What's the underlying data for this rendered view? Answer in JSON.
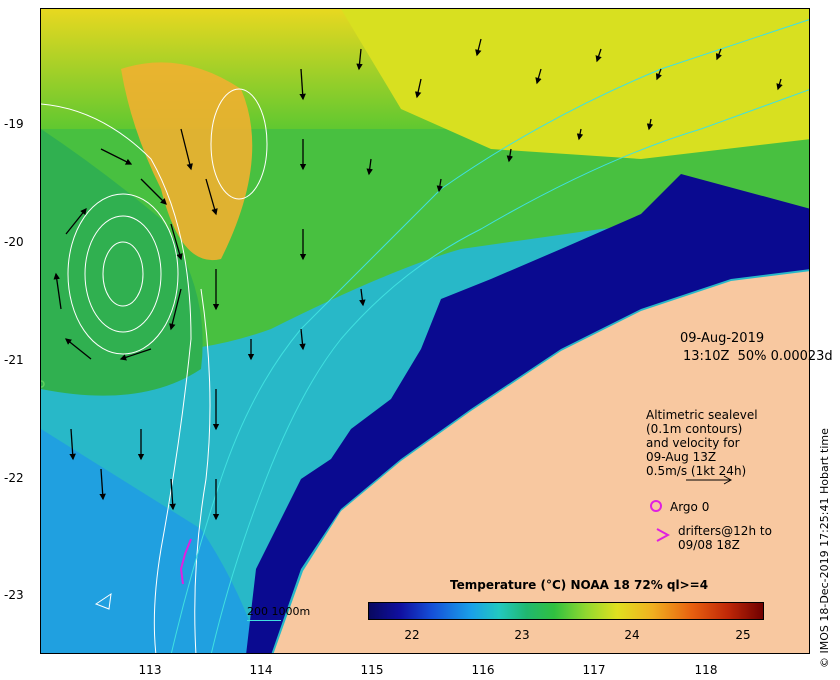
{
  "map": {
    "date": "09-Aug-2019",
    "time_line": "13:10Z  50% 0.00023d",
    "y_ticks": [
      "-19",
      "-20",
      "-21",
      "-22",
      "-23"
    ],
    "x_ticks": [
      "113",
      "114",
      "115",
      "116",
      "117",
      "118"
    ],
    "altimetry_legend": {
      "line1": "Altimetric sealevel",
      "line2": "(0.1m contours)",
      "line3": "and velocity for",
      "line4": "09-Aug 13Z",
      "line5": "0.5m/s (1kt 24h)"
    },
    "argo_label": "Argo 0",
    "drifters_line1": "drifters@12h to",
    "drifters_line2": "09/08 18Z",
    "depth_legend": "200  1000m",
    "colorbar_title": "Temperature (°C) NOAA 18 72% ql>=4",
    "colorbar_ticks": [
      "22",
      "23",
      "24",
      "25"
    ],
    "side_credit": "© IMOS 18-Dec-2019 17:25:41 Hobart time",
    "colors": {
      "land": "#f8c8a0",
      "warm": "#f0b428",
      "mid": "#40c040",
      "cool": "#18a8e0",
      "cold": "#0a0a90",
      "contour": "#ffffff",
      "isobath": "#40e0e0",
      "argo": "#e020e0"
    }
  }
}
